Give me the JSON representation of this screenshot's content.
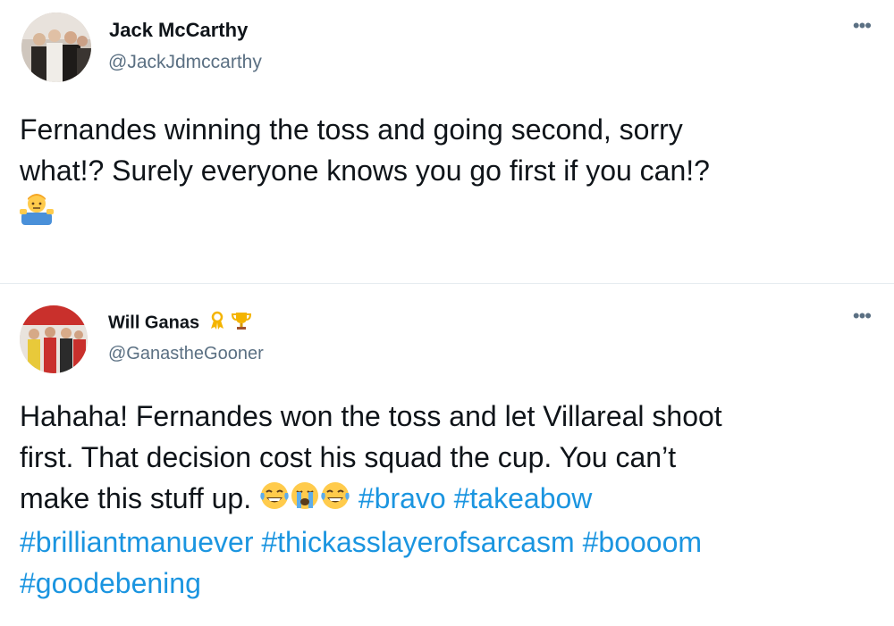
{
  "tweet1": {
    "name": "Jack McCarthy",
    "handle": "@JackJdmccarthy",
    "more_icon": "more-horizontal-icon",
    "text_line1": "Fernandes winning the toss and going second, sorry",
    "text_line2": "what!? Surely everyone knows you go first if you can!?",
    "emoji": "man-shrugging-emoji"
  },
  "tweet2": {
    "name": "Will Ganas",
    "badges": [
      "ribbon-icon",
      "trophy-icon"
    ],
    "handle": "@GanastheGooner",
    "more_icon": "more-horizontal-icon",
    "text_line1": "Hahaha! Fernandes won the toss and let Villareal shoot",
    "text_line2": "first. That decision cost his squad the cup. You can’t",
    "text_line3": "make this stuff up.",
    "emojis": [
      "face-with-tears-of-joy",
      "loudly-crying-face",
      "face-with-tears-of-joy"
    ],
    "hashtags": [
      "#bravo",
      "#takeabow",
      "#brilliantmanuever",
      "#thickasslayerofsarcasm",
      "#boooom",
      "#goodebening"
    ]
  },
  "colors": {
    "link": "#1b95e0",
    "secondary_text": "#5b7083",
    "primary_text": "#0f1419",
    "divider": "#e6ecf0"
  }
}
